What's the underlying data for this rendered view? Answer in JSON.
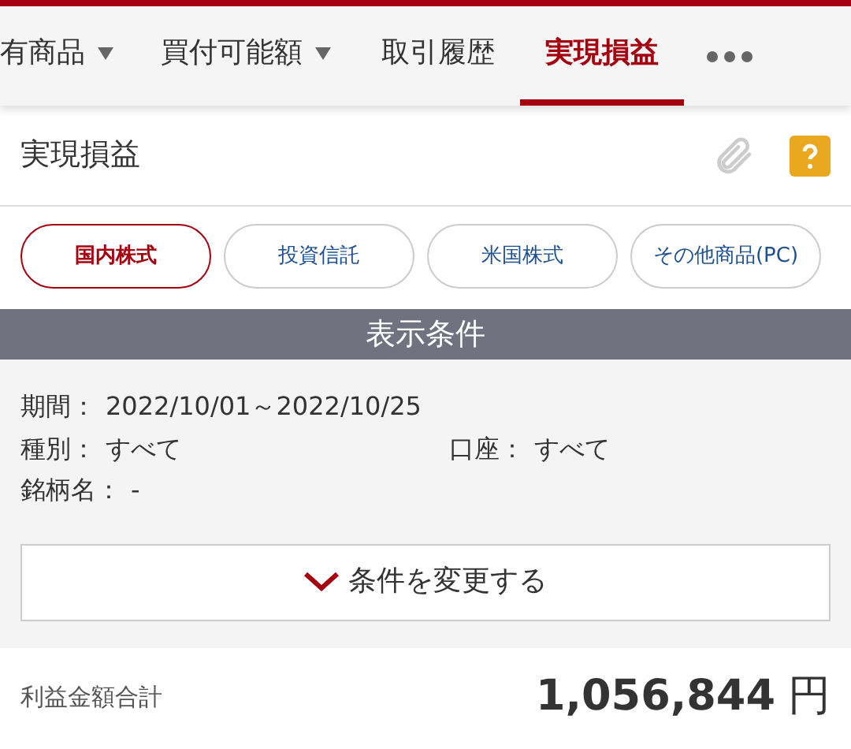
{
  "tabs": [
    {
      "label": "有商品",
      "dropdown": true,
      "selected": false
    },
    {
      "label": "買付可能額",
      "dropdown": true,
      "selected": false
    },
    {
      "label": "取引履歴",
      "dropdown": false,
      "selected": false
    },
    {
      "label": "実現損益",
      "dropdown": false,
      "selected": true
    }
  ],
  "page_title": "実現損益",
  "categories": [
    {
      "label": "国内株式",
      "selected": true
    },
    {
      "label": "投資信託",
      "selected": false
    },
    {
      "label": "米国株式",
      "selected": false
    },
    {
      "label": "その他商品(PC)",
      "selected": false
    }
  ],
  "conditions": {
    "title": "表示条件",
    "period": {
      "label": "期間：",
      "value": "2022/10/01～2022/10/25"
    },
    "type": {
      "label": "種別：",
      "value": "すべて"
    },
    "account": {
      "label": "口座：",
      "value": "すべて"
    },
    "name": {
      "label": "銘柄名：",
      "value": "-"
    },
    "change_button": "条件を変更する"
  },
  "total": {
    "label": "利益金額合計",
    "amount": "1,056,844",
    "unit": "円"
  }
}
